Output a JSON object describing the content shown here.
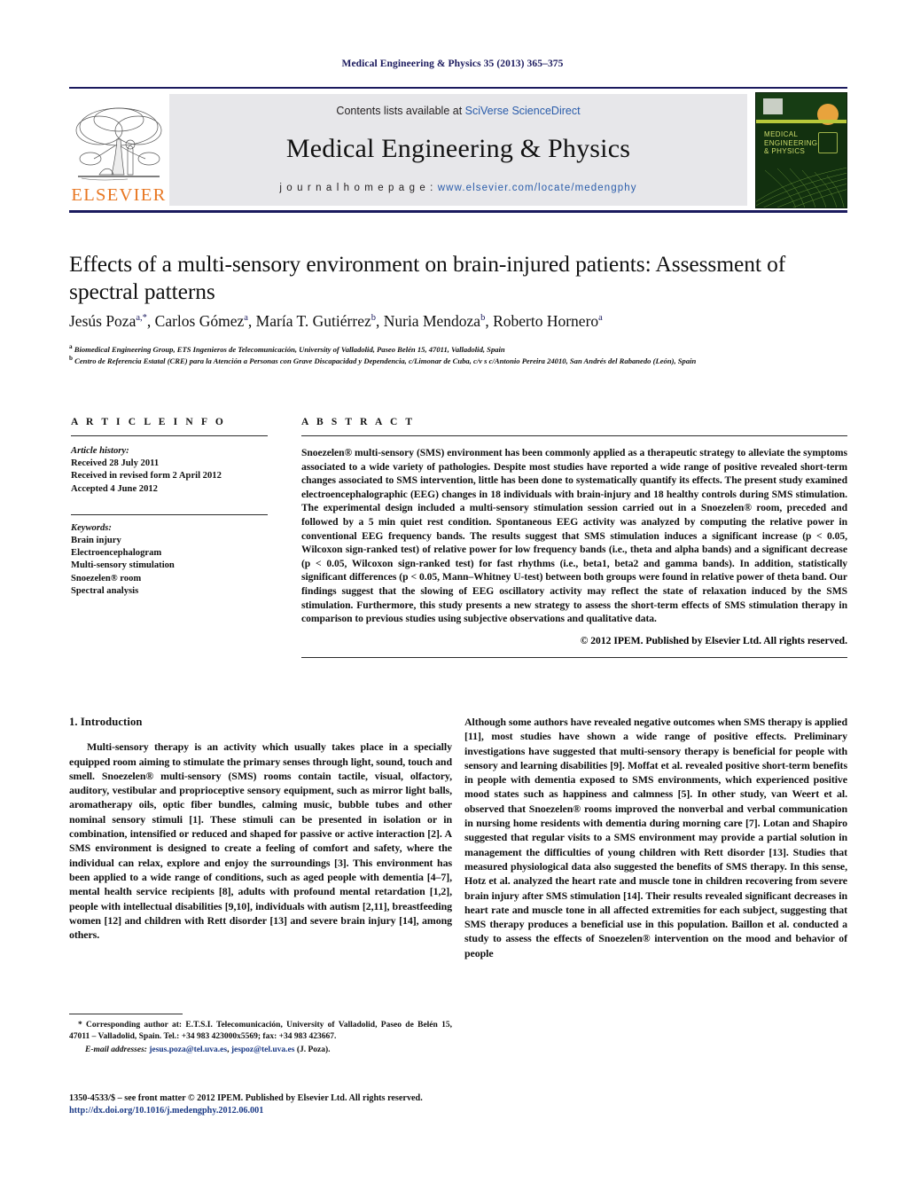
{
  "running_head": "Medical Engineering & Physics 35 (2013) 365–375",
  "masthead": {
    "contents_prefix": "Contents lists available at ",
    "contents_link": "SciVerse ScienceDirect",
    "journal_title": "Medical Engineering & Physics",
    "homepage_label": "j o u r n a l   h o m e p a g e :  ",
    "homepage_url": "www.elsevier.com/locate/medengphy",
    "publisher_name": "ELSEVIER",
    "cover_title": "MEDICAL\nENGINEERING\n& PHYSICS"
  },
  "article": {
    "title": "Effects of a multi-sensory environment on brain-injured patients: Assessment of spectral patterns",
    "authors": "Jesús Poza a,*, Carlos Gómez a, María T. Gutiérrez b, Nuria Mendoza b, Roberto Hornero a",
    "affiliation_a": "Biomedical Engineering Group, ETS Ingenieros de Telecomunicación, University of Valladolid, Paseo Belén 15, 47011, Valladolid, Spain",
    "affiliation_b": "Centro de Referencia Estatal (CRE) para la Atención a Personas con Grave Discapacidad y Dependencia, c/Limonar de Cuba, c/v s c/Antonio Pereira 24010, San Andrés del Rabanedo (León), Spain"
  },
  "article_info": {
    "heading": "A R T I C L E   I N F O",
    "history_label": "Article history:",
    "history": [
      "Received 28 July 2011",
      "Received in revised form 2 April 2012",
      "Accepted 4 June 2012"
    ],
    "keywords_label": "Keywords:",
    "keywords": [
      "Brain injury",
      "Electroencephalogram",
      "Multi-sensory stimulation",
      "Snoezelen® room",
      "Spectral analysis"
    ]
  },
  "abstract": {
    "heading": "A B S T R A C T",
    "text": "Snoezelen® multi-sensory (SMS) environment has been commonly applied as a therapeutic strategy to alleviate the symptoms associated to a wide variety of pathologies. Despite most studies have reported a wide range of positive revealed short-term changes associated to SMS intervention, little has been done to systematically quantify its effects. The present study examined electroencephalographic (EEG) changes in 18 individuals with brain-injury and 18 healthy controls during SMS stimulation. The experimental design included a multi-sensory stimulation session carried out in a Snoezelen® room, preceded and followed by a 5 min quiet rest condition. Spontaneous EEG activity was analyzed by computing the relative power in conventional EEG frequency bands. The results suggest that SMS stimulation induces a significant increase (p < 0.05, Wilcoxon sign-ranked test) of relative power for low frequency bands (i.e., theta and alpha bands) and a significant decrease (p < 0.05, Wilcoxon sign-ranked test) for fast rhythms (i.e., beta1, beta2 and gamma bands). In addition, statistically significant differences (p < 0.05, Mann–Whitney U-test) between both groups were found in relative power of theta band. Our findings suggest that the slowing of EEG oscillatory activity may reflect the state of relaxation induced by the SMS stimulation. Furthermore, this study presents a new strategy to assess the short-term effects of SMS stimulation therapy in comparison to previous studies using subjective observations and qualitative data.",
    "copyright": "© 2012 IPEM. Published by Elsevier Ltd. All rights reserved."
  },
  "introduction": {
    "heading": "1.  Introduction",
    "left_paragraph_1": "Multi-sensory therapy is an activity which usually takes place in a specially equipped room aiming to stimulate the primary senses through light, sound, touch and smell. Snoezelen® multi-sensory (SMS) rooms contain tactile, visual, olfactory, auditory, vestibular and proprioceptive sensory equipment, such as mirror light balls, aromatherapy oils, optic fiber bundles, calming music, bubble tubes and other nominal sensory stimuli [1]. These stimuli can be presented in isolation or in combination, intensified or reduced and shaped for passive or active interaction [2]. A SMS environment is designed to create a feeling of comfort and safety, where the individual can relax, explore and enjoy the surroundings [3]. This environment has been applied to a wide range of conditions, such as aged people with dementia [4–7], mental health service recipients [8], adults with profound mental retardation [1,2], people with intellectual disabilities [9,10], individuals with autism [2,11], breastfeeding women [12] and children with Rett disorder [13] and severe brain injury [14], among others.",
    "right_paragraph_2": "Although some authors have revealed negative outcomes when SMS therapy is applied [11], most studies have shown a wide range of positive effects. Preliminary investigations have suggested that multi-sensory therapy is beneficial for people with sensory and learning disabilities [9]. Moffat et al. revealed positive short-term benefits in people with dementia exposed to SMS environments, which experienced positive mood states such as happiness and calmness [5]. In other study, van Weert et al. observed that Snoezelen® rooms improved the nonverbal and verbal communication in nursing home residents with dementia during morning care [7]. Lotan and Shapiro suggested that regular visits to a SMS environment may provide a partial solution in management the difficulties of young children with Rett disorder [13]. Studies that measured physiological data also suggested the benefits of SMS therapy. In this sense, Hotz et al. analyzed the heart rate and muscle tone in children recovering from severe brain injury after SMS stimulation [14]. Their results revealed significant decreases in heart rate and muscle tone in all affected extremities for each subject, suggesting that SMS therapy produces a beneficial use in this population. Baillon et al. conducted a study to assess the effects of Snoezelen® intervention on the mood and behavior of people"
  },
  "footnote": {
    "corresponding": "* Corresponding author at: E.T.S.I. Telecomunicación, University of Valladolid, Paseo de Belén 15, 47011 – Valladolid, Spain. Tel.: +34 983 423000x5569; fax: +34 983 423667.",
    "email_label": "E-mail addresses:",
    "email_1": "jesus.poza@tel.uva.es",
    "email_2": "jespoz@tel.uva.es",
    "email_suffix": "(J. Poza)."
  },
  "frontmatter": {
    "line": "1350-4533/$ – see front matter © 2012 IPEM. Published by Elsevier Ltd. All rights reserved.",
    "doi": "http://dx.doi.org/10.1016/j.medengphy.2012.06.001"
  },
  "colors": {
    "navy": "#1b1a5e",
    "link_blue": "#2a5caa",
    "ref_blue": "#1b3a86",
    "elsevier_orange": "#e87722",
    "banner_gray": "#e7e7ea",
    "cover_green": "#12300f"
  }
}
